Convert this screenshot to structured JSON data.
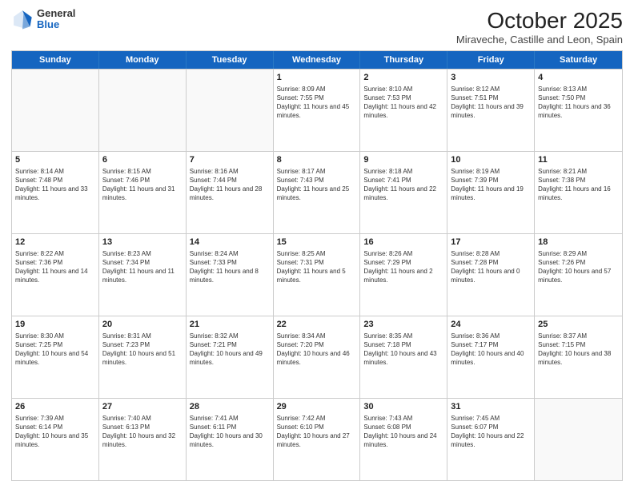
{
  "header": {
    "logo": {
      "general": "General",
      "blue": "Blue"
    },
    "month": "October 2025",
    "subtitle": "Miraveche, Castille and Leon, Spain"
  },
  "weekdays": [
    "Sunday",
    "Monday",
    "Tuesday",
    "Wednesday",
    "Thursday",
    "Friday",
    "Saturday"
  ],
  "rows": [
    [
      {
        "day": "",
        "info": ""
      },
      {
        "day": "",
        "info": ""
      },
      {
        "day": "",
        "info": ""
      },
      {
        "day": "1",
        "info": "Sunrise: 8:09 AM\nSunset: 7:55 PM\nDaylight: 11 hours and 45 minutes."
      },
      {
        "day": "2",
        "info": "Sunrise: 8:10 AM\nSunset: 7:53 PM\nDaylight: 11 hours and 42 minutes."
      },
      {
        "day": "3",
        "info": "Sunrise: 8:12 AM\nSunset: 7:51 PM\nDaylight: 11 hours and 39 minutes."
      },
      {
        "day": "4",
        "info": "Sunrise: 8:13 AM\nSunset: 7:50 PM\nDaylight: 11 hours and 36 minutes."
      }
    ],
    [
      {
        "day": "5",
        "info": "Sunrise: 8:14 AM\nSunset: 7:48 PM\nDaylight: 11 hours and 33 minutes."
      },
      {
        "day": "6",
        "info": "Sunrise: 8:15 AM\nSunset: 7:46 PM\nDaylight: 11 hours and 31 minutes."
      },
      {
        "day": "7",
        "info": "Sunrise: 8:16 AM\nSunset: 7:44 PM\nDaylight: 11 hours and 28 minutes."
      },
      {
        "day": "8",
        "info": "Sunrise: 8:17 AM\nSunset: 7:43 PM\nDaylight: 11 hours and 25 minutes."
      },
      {
        "day": "9",
        "info": "Sunrise: 8:18 AM\nSunset: 7:41 PM\nDaylight: 11 hours and 22 minutes."
      },
      {
        "day": "10",
        "info": "Sunrise: 8:19 AM\nSunset: 7:39 PM\nDaylight: 11 hours and 19 minutes."
      },
      {
        "day": "11",
        "info": "Sunrise: 8:21 AM\nSunset: 7:38 PM\nDaylight: 11 hours and 16 minutes."
      }
    ],
    [
      {
        "day": "12",
        "info": "Sunrise: 8:22 AM\nSunset: 7:36 PM\nDaylight: 11 hours and 14 minutes."
      },
      {
        "day": "13",
        "info": "Sunrise: 8:23 AM\nSunset: 7:34 PM\nDaylight: 11 hours and 11 minutes."
      },
      {
        "day": "14",
        "info": "Sunrise: 8:24 AM\nSunset: 7:33 PM\nDaylight: 11 hours and 8 minutes."
      },
      {
        "day": "15",
        "info": "Sunrise: 8:25 AM\nSunset: 7:31 PM\nDaylight: 11 hours and 5 minutes."
      },
      {
        "day": "16",
        "info": "Sunrise: 8:26 AM\nSunset: 7:29 PM\nDaylight: 11 hours and 2 minutes."
      },
      {
        "day": "17",
        "info": "Sunrise: 8:28 AM\nSunset: 7:28 PM\nDaylight: 11 hours and 0 minutes."
      },
      {
        "day": "18",
        "info": "Sunrise: 8:29 AM\nSunset: 7:26 PM\nDaylight: 10 hours and 57 minutes."
      }
    ],
    [
      {
        "day": "19",
        "info": "Sunrise: 8:30 AM\nSunset: 7:25 PM\nDaylight: 10 hours and 54 minutes."
      },
      {
        "day": "20",
        "info": "Sunrise: 8:31 AM\nSunset: 7:23 PM\nDaylight: 10 hours and 51 minutes."
      },
      {
        "day": "21",
        "info": "Sunrise: 8:32 AM\nSunset: 7:21 PM\nDaylight: 10 hours and 49 minutes."
      },
      {
        "day": "22",
        "info": "Sunrise: 8:34 AM\nSunset: 7:20 PM\nDaylight: 10 hours and 46 minutes."
      },
      {
        "day": "23",
        "info": "Sunrise: 8:35 AM\nSunset: 7:18 PM\nDaylight: 10 hours and 43 minutes."
      },
      {
        "day": "24",
        "info": "Sunrise: 8:36 AM\nSunset: 7:17 PM\nDaylight: 10 hours and 40 minutes."
      },
      {
        "day": "25",
        "info": "Sunrise: 8:37 AM\nSunset: 7:15 PM\nDaylight: 10 hours and 38 minutes."
      }
    ],
    [
      {
        "day": "26",
        "info": "Sunrise: 7:39 AM\nSunset: 6:14 PM\nDaylight: 10 hours and 35 minutes."
      },
      {
        "day": "27",
        "info": "Sunrise: 7:40 AM\nSunset: 6:13 PM\nDaylight: 10 hours and 32 minutes."
      },
      {
        "day": "28",
        "info": "Sunrise: 7:41 AM\nSunset: 6:11 PM\nDaylight: 10 hours and 30 minutes."
      },
      {
        "day": "29",
        "info": "Sunrise: 7:42 AM\nSunset: 6:10 PM\nDaylight: 10 hours and 27 minutes."
      },
      {
        "day": "30",
        "info": "Sunrise: 7:43 AM\nSunset: 6:08 PM\nDaylight: 10 hours and 24 minutes."
      },
      {
        "day": "31",
        "info": "Sunrise: 7:45 AM\nSunset: 6:07 PM\nDaylight: 10 hours and 22 minutes."
      },
      {
        "day": "",
        "info": ""
      }
    ]
  ]
}
